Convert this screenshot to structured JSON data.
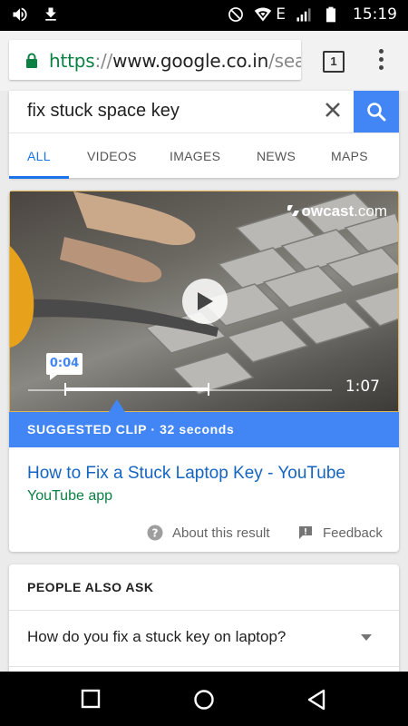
{
  "status_bar": {
    "time": "15:19",
    "network_type": "E",
    "icons": [
      "volume-icon",
      "download-icon",
      "do-not-disturb-icon",
      "wifi-icon",
      "signal-icon",
      "battery-icon"
    ]
  },
  "browser": {
    "url_scheme": "https",
    "url_separator": "://",
    "url_host": "www.google.co.in",
    "url_path": "/sear",
    "tab_count": "1"
  },
  "search": {
    "query": "fix stuck space key",
    "tabs": [
      {
        "label": "ALL"
      },
      {
        "label": "VIDEOS"
      },
      {
        "label": "IMAGES"
      },
      {
        "label": "NEWS"
      },
      {
        "label": "MAPS"
      }
    ],
    "active_tab": "ALL"
  },
  "result": {
    "video": {
      "watermark_name": "owcast",
      "watermark_domain": ".com",
      "clip_start": "0:04",
      "duration": "1:07",
      "clip_start_seconds": 4,
      "clip_length_seconds": 32,
      "duration_seconds": 67
    },
    "clip_banner": "SUGGESTED CLIP · 32 seconds",
    "title": "How to Fix a Stuck Laptop Key - YouTube",
    "source": "YouTube app",
    "about_label": "About this result",
    "feedback_label": "Feedback"
  },
  "people_also_ask": {
    "heading": "PEOPLE ALSO ASK",
    "questions": [
      "How do you fix a stuck key on laptop?"
    ]
  },
  "colors": {
    "accent": "#4285f4",
    "link": "#1565c0",
    "url_green": "#0b8043"
  }
}
